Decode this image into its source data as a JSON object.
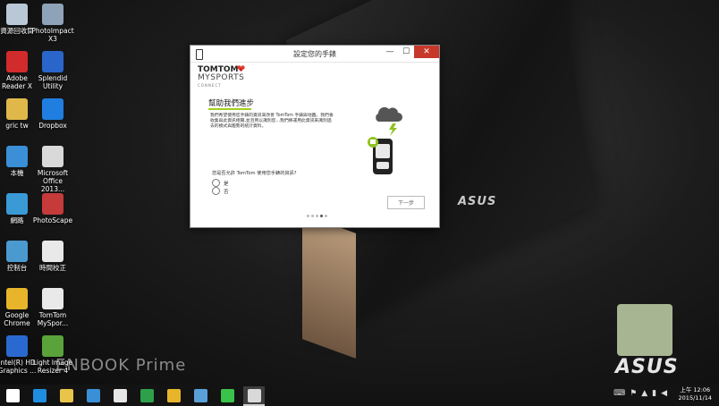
{
  "desktop": {
    "icons": [
      {
        "label": "資源回收筒",
        "color": "#b9c7d6"
      },
      {
        "label": "PhotoImpact X3",
        "color": "#8fa3b8"
      },
      {
        "label": "Adobe Reader X",
        "color": "#d22b2b"
      },
      {
        "label": "Splendid Utility",
        "color": "#2a66c9"
      },
      {
        "label": "gric tw",
        "color": "#e0b84a"
      },
      {
        "label": "Dropbox",
        "color": "#1f7ee0"
      },
      {
        "label": "本機",
        "color": "#3a8fd6"
      },
      {
        "label": "Microsoft Office 2013...",
        "color": "#d9d9d9"
      },
      {
        "label": "網路",
        "color": "#3a9ad6"
      },
      {
        "label": "PhotoScape",
        "color": "#c53a3a"
      },
      {
        "label": "控制台",
        "color": "#4a9ad0"
      },
      {
        "label": "時間校正",
        "color": "#e9e9e9"
      },
      {
        "label": "Google Chrome",
        "color": "#e8b52a"
      },
      {
        "label": "TomTom MySpor...",
        "color": "#e9e9e9"
      },
      {
        "label": "Intel(R) HD Graphics ...",
        "color": "#2a6ad0"
      },
      {
        "label": "Light Image Resizer 4",
        "color": "#5aa33a"
      }
    ]
  },
  "wallpaper": {
    "lid_text": "ASUS",
    "brand_text": "ENBOOK Prime",
    "logo_text": "ASUS"
  },
  "dialog": {
    "title": "設定您的手錶",
    "controls": {
      "minimize": "—",
      "maximize": "☐",
      "close": "✕"
    },
    "logo": {
      "tomtom": "TOMTOM",
      "mysports": "MYSPORTS",
      "connect": "CONNECT"
    },
    "heading": "幫助我們進步",
    "body": "我們希望使用您手錶的資訊來改善 TomTom 手錶與地圖。我們會收集與此資訊相關,並且用以識別您...我們將運用此資訊來識別過去的模式與趨勢的統計資料。",
    "question": "您是否允許 TomTom 使用您手錶的資訊?",
    "options": {
      "yes": "是",
      "no": "否"
    },
    "next_label": "下一步",
    "accent": "#a3cf1d",
    "page_indicator": {
      "total": 5,
      "current": 4
    }
  },
  "taskbar": {
    "items": [
      {
        "icon": "start-icon"
      },
      {
        "icon": "internet-explorer-icon"
      },
      {
        "icon": "file-explorer-icon"
      },
      {
        "icon": "remote-desktop-icon"
      },
      {
        "icon": "7zip-icon"
      },
      {
        "icon": "store-icon"
      },
      {
        "icon": "chrome-icon"
      },
      {
        "icon": "app-icon"
      },
      {
        "icon": "line-icon"
      },
      {
        "icon": "tomtom-icon"
      }
    ],
    "clock": {
      "time": "上午 12:06",
      "date": "2015/11/14"
    }
  }
}
